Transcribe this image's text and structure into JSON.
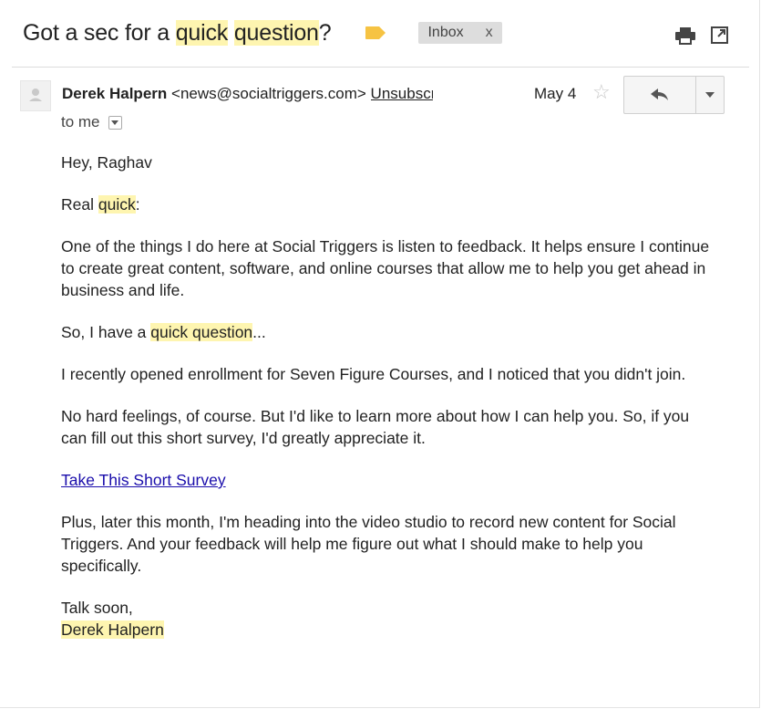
{
  "email": {
    "subject_parts": [
      "Got a sec for a ",
      "quick",
      " ",
      "question",
      "?"
    ],
    "label": "Inbox",
    "label_close": "x",
    "sender_name": "Derek Halpern",
    "sender_email": "<news@socialtriggers.com>",
    "unsubscribe": "Unsubscribe",
    "date": "May 4",
    "to": "to me",
    "greeting": "Hey, Raghav",
    "p1_a": "Real ",
    "p1_hl": "quick",
    "p1_b": ":",
    "p2": "One of the things I do here at Social Triggers is listen to feedback. It helps ensure I continue to create great content, software, and online courses that allow me to help you get ahead in business and life.",
    "p3_a": "So, I have a ",
    "p3_hl1": "quick",
    "p3_sp": " ",
    "p3_hl2": "question",
    "p3_b": "...",
    "p4": "I recently opened enrollment for Seven Figure Courses, and I noticed that you didn't join.",
    "p5": "No hard feelings, of course. But I'd like to learn more about how I can help you. So, if you can fill out this short survey, I'd greatly appreciate it.",
    "survey_link": "Take This Short Survey",
    "p6": "Plus, later this month, I'm heading into the video studio to record new content for Social Triggers. And your feedback will help me figure out what I should make to help you specifically.",
    "signoff": "Talk soon,",
    "signature": "Derek Halpern"
  },
  "icons": {
    "label_tag_color": "#f6c343",
    "highlight_color": "#fef5b0",
    "print": "print-icon",
    "new_window": "new-window-icon",
    "star": "star-icon",
    "reply": "reply-icon",
    "more": "chevron-down-icon"
  }
}
